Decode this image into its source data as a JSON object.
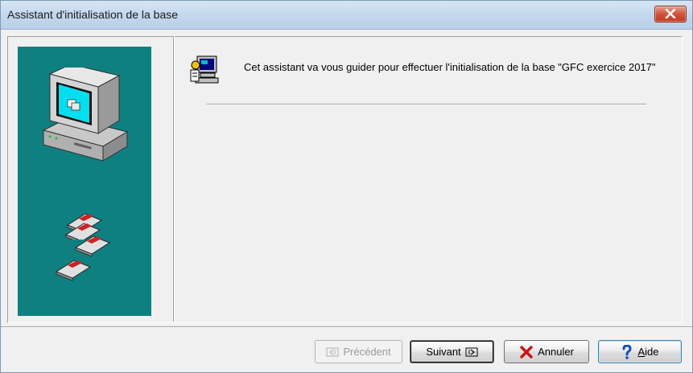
{
  "window": {
    "title": "Assistant d'initialisation de la base"
  },
  "content": {
    "intro_text": "Cet assistant va vous guider pour effectuer l'initialisation de la base \"GFC exercice 2017\""
  },
  "buttons": {
    "previous_label": "Précédent",
    "next_label": "Suivant",
    "cancel_label": "Annuler",
    "help_label": "Aide"
  },
  "colors": {
    "side_panel": "#0f8080",
    "title_bar": "#c4d8ee",
    "close_button": "#d0543a"
  },
  "icons": {
    "close": "close-icon",
    "computer": "computer-icon",
    "floppies": "floppy-disk-icon",
    "wizard": "wizard-computer-icon",
    "previous": "previous-arrow-icon",
    "next": "next-arrow-icon",
    "cancel": "red-x-icon",
    "help": "question-mark-icon"
  }
}
